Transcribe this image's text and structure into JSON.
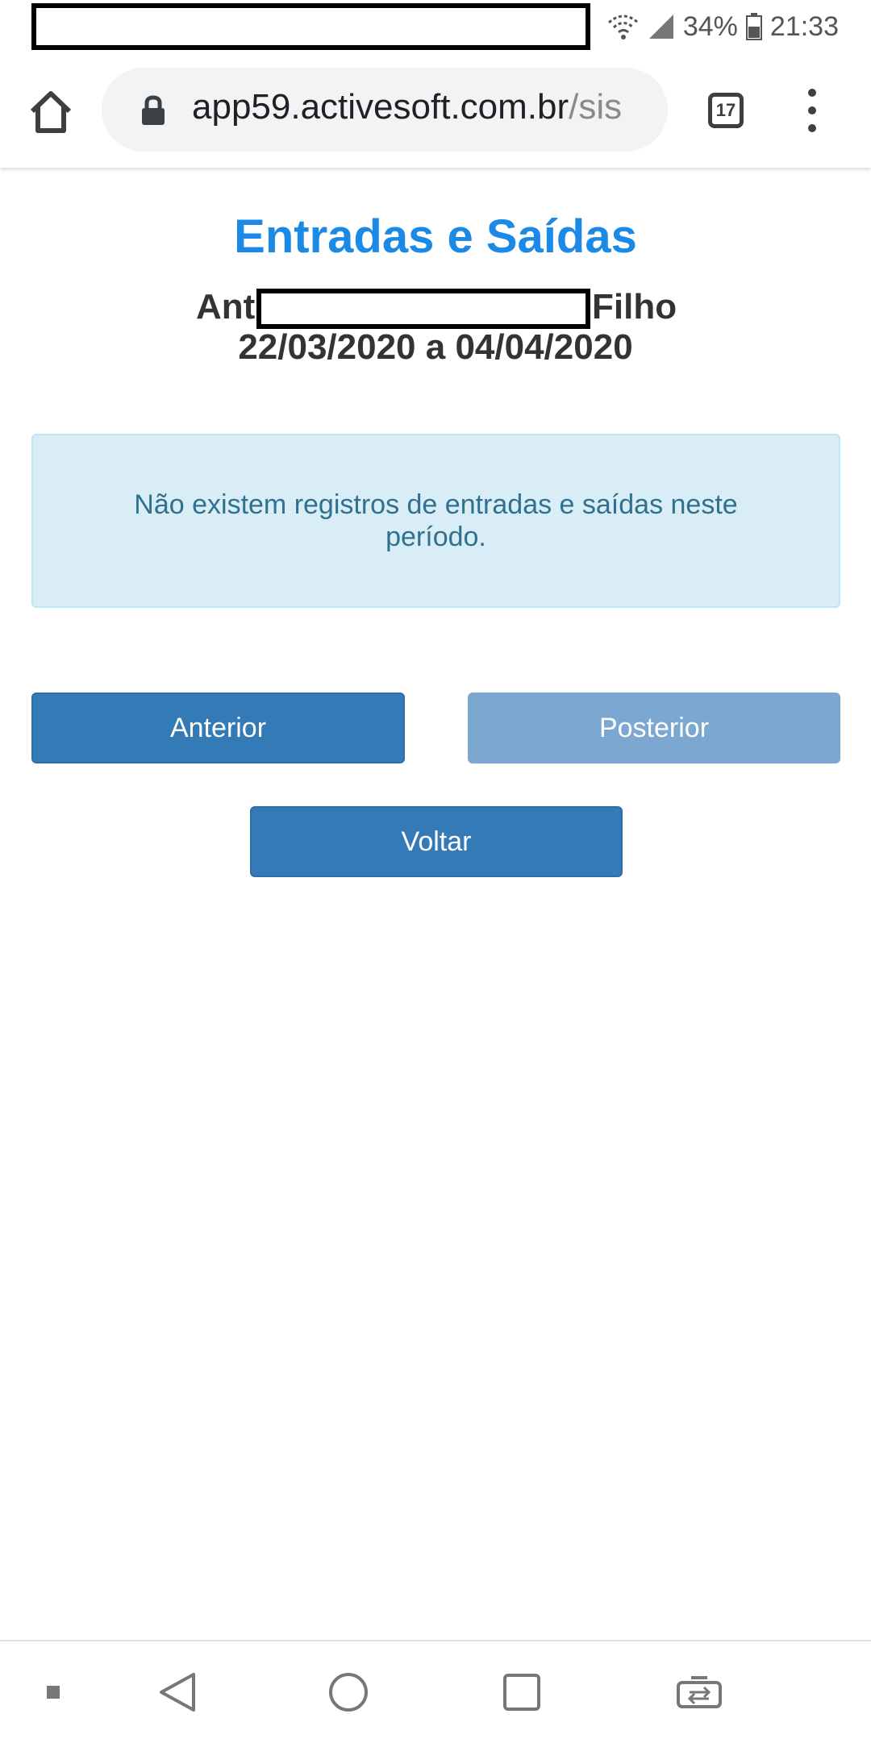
{
  "status_bar": {
    "battery": "34%",
    "time": "21:33"
  },
  "browser": {
    "url_main": "app59.activesoft.com.br",
    "url_rest": "/sis",
    "tab_count": "17"
  },
  "page": {
    "title": "Entradas e Saídas",
    "student_first": "Ant",
    "student_last": "Filho",
    "date_range": "22/03/2020 a 04/04/2020",
    "alert_text": "Não existem registros de entradas e saídas neste período."
  },
  "buttons": {
    "previous": "Anterior",
    "next": "Posterior",
    "back": "Voltar"
  },
  "colors": {
    "title": "#1a8ae6",
    "button_primary": "#337ab7",
    "button_disabled": "#7ba7d0",
    "alert_bg": "#d9edf7",
    "alert_text": "#31708f"
  },
  "icons": {
    "status": [
      "wifi-icon",
      "signal-icon",
      "battery-icon"
    ],
    "browser": [
      "home-icon",
      "lock-icon",
      "tabs-icon",
      "menu-icon"
    ],
    "nav": [
      "nav-dot-icon",
      "back-icon",
      "home-circle-icon",
      "recents-icon",
      "switch-app-icon"
    ]
  }
}
